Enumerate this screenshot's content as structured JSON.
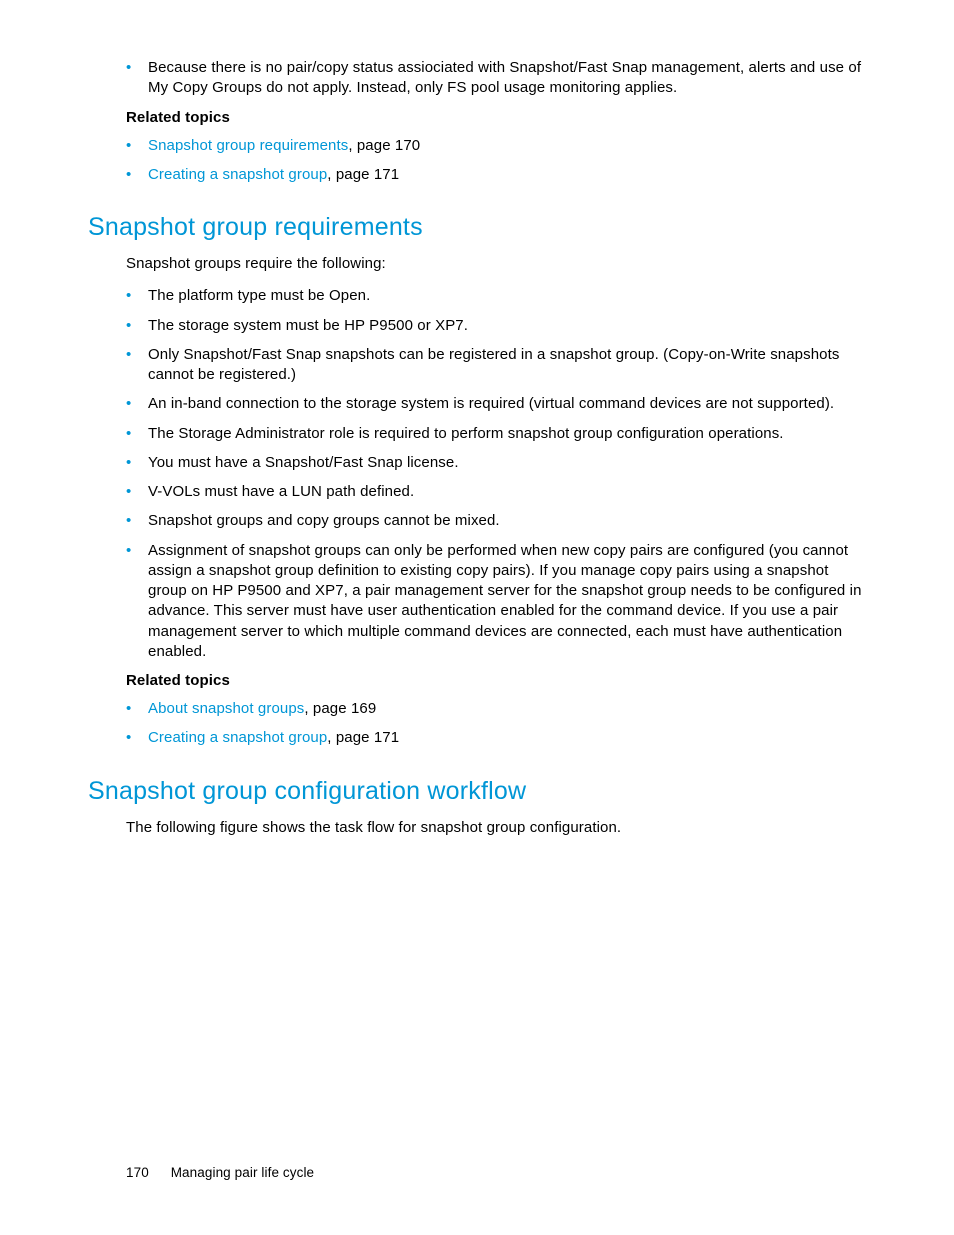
{
  "top_bullets": [
    "Because there is no pair/copy status assiociated with Snapshot/Fast Snap management, alerts and use of My Copy Groups do not apply. Instead, only FS pool usage monitoring applies."
  ],
  "top_related": {
    "heading": "Related topics",
    "items": [
      {
        "link": "Snapshot group requirements",
        "suffix": ", page 170"
      },
      {
        "link": "Creating a snapshot group",
        "suffix": ", page 171"
      }
    ]
  },
  "section1": {
    "heading": "Snapshot group requirements",
    "intro": "Snapshot groups require the following:",
    "bullets": [
      "The platform type must be Open.",
      "The storage system must be HP P9500 or XP7.",
      "Only Snapshot/Fast Snap snapshots can be registered in a snapshot group. (Copy-on-Write snapshots cannot be registered.)",
      "An in-band connection to the storage system is required (virtual command devices are not supported).",
      "The Storage Administrator role is required to perform snapshot group configuration operations.",
      "You must have a Snapshot/Fast Snap license.",
      "V-VOLs must have a LUN path defined.",
      "Snapshot groups and copy groups cannot be mixed.",
      "Assignment of snapshot groups can only be performed when new copy pairs are configured (you cannot assign a snapshot group definition to existing copy pairs). If you manage copy pairs using a snapshot group on HP P9500 and XP7, a pair management server for the snapshot group needs to be configured in advance. This server must have user authentication enabled for the command device. If you use a pair management server to which multiple command devices are connected, each must have authentication enabled."
    ],
    "related": {
      "heading": "Related topics",
      "items": [
        {
          "link": "About snapshot groups",
          "suffix": ", page 169"
        },
        {
          "link": "Creating a snapshot group",
          "suffix": ", page 171"
        }
      ]
    }
  },
  "section2": {
    "heading": "Snapshot group configuration workflow",
    "intro": "The following figure shows the task flow for snapshot group configuration."
  },
  "footer": {
    "page_number": "170",
    "chapter": "Managing pair life cycle"
  }
}
